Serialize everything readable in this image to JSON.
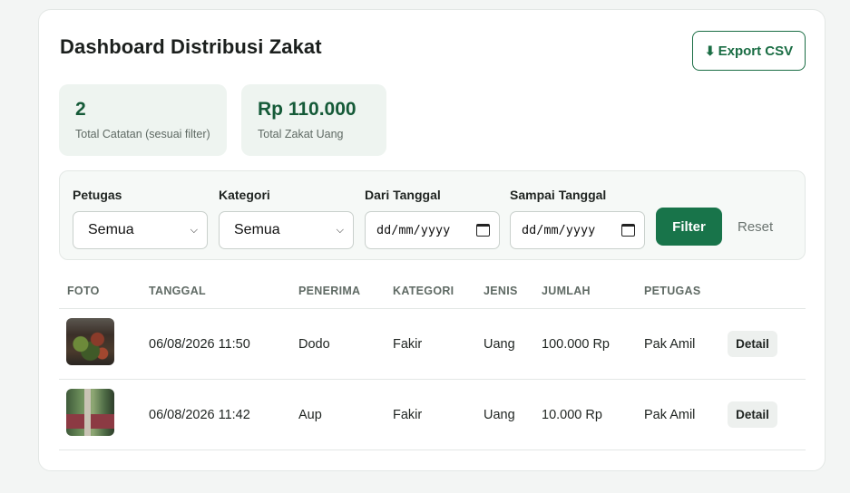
{
  "header": {
    "title": "Dashboard Distribusi Zakat",
    "export_label": "Export CSV",
    "export_icon": "⬇"
  },
  "stats": [
    {
      "value": "2",
      "label": "Total Catatan (sesuai filter)"
    },
    {
      "value": "Rp 110.000",
      "label": "Total Zakat Uang"
    }
  ],
  "filters": {
    "petugas": {
      "label": "Petugas",
      "value": "Semua"
    },
    "kategori": {
      "label": "Kategori",
      "value": "Semua"
    },
    "dari": {
      "label": "Dari Tanggal",
      "placeholder": "dd/mm/yyyy"
    },
    "sampai": {
      "label": "Sampai Tanggal",
      "placeholder": "dd/mm/yyyy"
    },
    "filter_label": "Filter",
    "reset_label": "Reset"
  },
  "table": {
    "columns": [
      "FOTO",
      "TANGGAL",
      "PENERIMA",
      "KATEGORI",
      "JENIS",
      "JUMLAH",
      "PETUGAS"
    ],
    "rows": [
      {
        "tanggal": "06/08/2026 11:50",
        "penerima": "Dodo",
        "kategori": "Fakir",
        "jenis": "Uang",
        "jumlah": "100.000 Rp",
        "petugas": "Pak Amil",
        "action": "Detail"
      },
      {
        "tanggal": "06/08/2026 11:42",
        "penerima": "Aup",
        "kategori": "Fakir",
        "jenis": "Uang",
        "jumlah": "10.000 Rp",
        "petugas": "Pak Amil",
        "action": "Detail"
      }
    ]
  },
  "colors": {
    "accent": "#18744a",
    "stat_bg": "#eef4f0",
    "stat_text": "#155a38"
  }
}
